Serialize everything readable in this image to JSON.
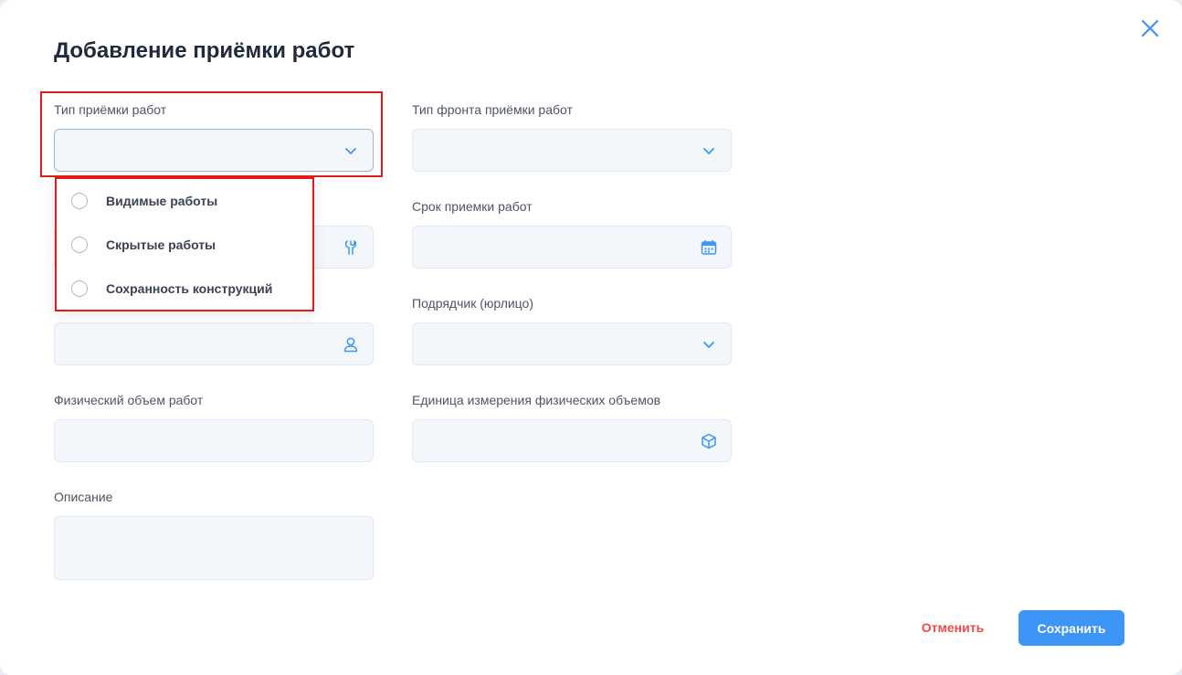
{
  "dialog": {
    "title": "Добавление приёмки работ",
    "close_icon": "close-icon"
  },
  "form": {
    "acceptance_type": {
      "label": "Тип приёмки работ",
      "value": "",
      "icon": "chevron-down-icon"
    },
    "front_type": {
      "label": "Тип фронта приёмки работ",
      "value": "",
      "icon": "chevron-down-icon"
    },
    "work_field": {
      "value": "",
      "icon": "wrench-icon"
    },
    "deadline": {
      "label": "Срок приемки работ",
      "value": "",
      "icon": "calendar-icon"
    },
    "person_field": {
      "value": "",
      "icon": "user-icon"
    },
    "contractor": {
      "label": "Подрядчик (юрлицо)",
      "value": "",
      "icon": "chevron-down-icon"
    },
    "physical_volume": {
      "label": "Физический объем работ",
      "value": ""
    },
    "unit": {
      "label": "Единица измерения физических объемов",
      "value": "",
      "icon": "cube-icon"
    },
    "description": {
      "label": "Описание",
      "value": ""
    }
  },
  "dropdown": {
    "options": [
      {
        "label": "Видимые работы",
        "selected": false
      },
      {
        "label": "Скрытые работы",
        "selected": false
      },
      {
        "label": "Сохранность конструкций",
        "selected": false
      }
    ]
  },
  "actions": {
    "cancel_label": "Отменить",
    "save_label": "Сохранить"
  },
  "colors": {
    "accent": "#3d95f5",
    "danger": "#f04a4a",
    "highlight": "#e01b1b",
    "field_bg": "#f3f7fb"
  }
}
